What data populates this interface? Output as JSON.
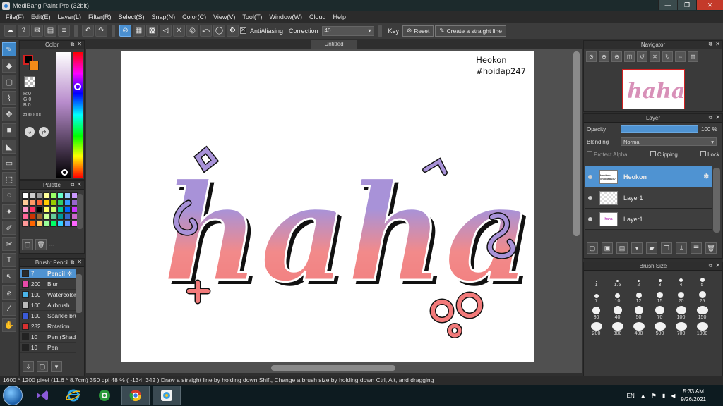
{
  "window": {
    "title": "MediBang Paint Pro (32bit)"
  },
  "menu": [
    "File(F)",
    "Edit(E)",
    "Layer(L)",
    "Filter(R)",
    "Select(S)",
    "Snap(N)",
    "Color(C)",
    "View(V)",
    "Tool(T)",
    "Window(W)",
    "Cloud",
    "Help"
  ],
  "toolbar": {
    "antialiasing_label": "AntiAliasing",
    "correction_label": "Correction",
    "correction_value": "40",
    "key_label": "Key",
    "reset_label": "Reset",
    "straight_line_label": "Create a straight line"
  },
  "color_panel": {
    "title": "Color",
    "r": "R:0",
    "g": "G:0",
    "b": "B:0",
    "hex": "#000000",
    "fg_color": "#000000",
    "bg_color": "#f28a18"
  },
  "palette": {
    "title": "Palette",
    "colors": [
      "#ffffff",
      "#cccccc",
      "#999999",
      "#ffff99",
      "#99ff66",
      "#66ffcc",
      "#99ccff",
      "#cc99ff",
      "#ffcc99",
      "#ff9966",
      "#ff6633",
      "#ffcc00",
      "#99cc00",
      "#33cc66",
      "#3399ff",
      "#9966cc",
      "#ff99cc",
      "#ff3366",
      "#000000",
      "#ffff66",
      "#ccff66",
      "#00cc99",
      "#0066ff",
      "#cc33ff",
      "#ff6699",
      "#cc3300",
      "#996633",
      "#ccff99",
      "#66cc99",
      "#009999",
      "#3366cc",
      "#cc66cc",
      "#ff9999",
      "#ff6600",
      "#ffcc66",
      "#99ff99",
      "#00ff66",
      "#33ccff",
      "#6699ff",
      "#ff66ff"
    ],
    "extra_label": "---"
  },
  "brush_panel": {
    "title": "Brush: Pencil",
    "items": [
      {
        "size": "7",
        "name": "Pencil",
        "color": "#2b2b2b"
      },
      {
        "size": "200",
        "name": "Blur",
        "color": "#e84aa8"
      },
      {
        "size": "100",
        "name": "Watercolor",
        "color": "#4ab4e8"
      },
      {
        "size": "100",
        "name": "Airbrush",
        "color": "#bbbbbb"
      },
      {
        "size": "100",
        "name": "Sparkle brush",
        "color": "#3a5ad8"
      },
      {
        "size": "282",
        "name": "Rotation",
        "color": "#d83030"
      },
      {
        "size": "10",
        "name": "Pen (Shading)",
        "color": "#222222"
      },
      {
        "size": "10",
        "name": "Pen",
        "color": "#222222"
      }
    ]
  },
  "document": {
    "tab": "Untitled",
    "text_line1": "Heokon",
    "text_line2": "#hoidap247",
    "art_word": "haha"
  },
  "navigator": {
    "title": "Navigator"
  },
  "layer_panel": {
    "title": "Layer",
    "opacity_label": "Opacity",
    "opacity_value": "100 %",
    "opacity_fraction": 1.0,
    "blending_label": "Blending",
    "blending_value": "Normal",
    "protect_alpha": "Protect Alpha",
    "clipping": "Clipping",
    "lock": "Lock",
    "layers": [
      {
        "name": "Heokon",
        "thumb": "Heokon #hoidap247",
        "active": true
      },
      {
        "name": "Layer1",
        "thumb": "",
        "active": false
      },
      {
        "name": "Layer1",
        "thumb": "haha",
        "active": false
      }
    ]
  },
  "brush_size": {
    "title": "Brush Size",
    "sizes": [
      "1",
      "1.5",
      "2",
      "3",
      "4",
      "5",
      "7",
      "10",
      "12",
      "15",
      "20",
      "25",
      "30",
      "40",
      "50",
      "70",
      "100",
      "150",
      "200",
      "300",
      "400",
      "500",
      "700",
      "1000"
    ]
  },
  "status": {
    "text": "1600 * 1200 pixel  (11.6 * 8.7cm)  350 dpi  48 %  ( -134, 342 )  Draw a straight line by holding down Shift, Change a brush size by holding down Ctrl, Alt, and dragging"
  },
  "taskbar": {
    "lang": "EN",
    "time": "5:33 AM",
    "date": "9/26/2021"
  }
}
